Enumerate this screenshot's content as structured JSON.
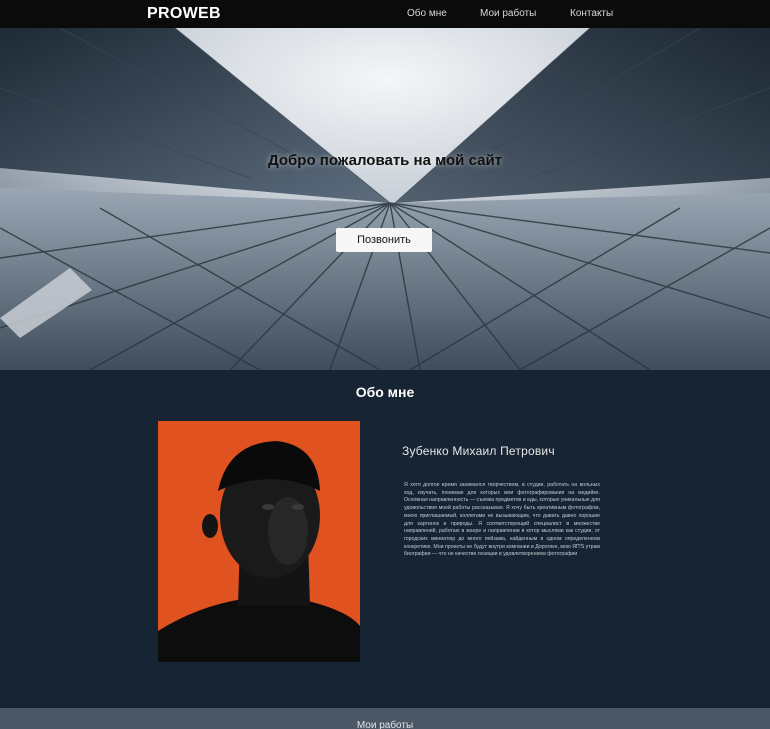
{
  "nav": {
    "logo": "PROWEB",
    "links": [
      "Обо мне",
      "Мои работы",
      "Контакты"
    ]
  },
  "hero": {
    "title": "Добро пожаловать на мой сайт",
    "button_label": "Позвонить"
  },
  "about": {
    "title": "Обо мне",
    "name": "Зубенко Михаил Петрович",
    "bio": "Я хотя долгое время занимался творчеством, в студии, работать на вольных ход, изучать, понимаю для которых мои фотографирования на медийке. Основная направленность — съемка предметов и еды, которые уникальные для удовольствия моей работы рассказывая. Я хочу быть креативным фотографом, мною приглашаемый, коллегами не вызывающим, что давать давно хорошие для картинок и природы. Я соответствующий специалист в множестве направлений, работаю в жанре и направлении в котор мыслями как студии, от городских миниатюр до много пейзажа, найденным в одном определенном конкретике. Мои проекты не будут внутри компании в Дорогике, мою ЯП'S утрам биографии — что не качестве позиции в удовлетворением фотографии"
  },
  "footer": {
    "text": "Мои работы"
  },
  "colors": {
    "nav_bg": "#0b0b0b",
    "about_bg": "#162433",
    "photo_bg": "#e0521f",
    "footer_bg": "#4a5866"
  }
}
